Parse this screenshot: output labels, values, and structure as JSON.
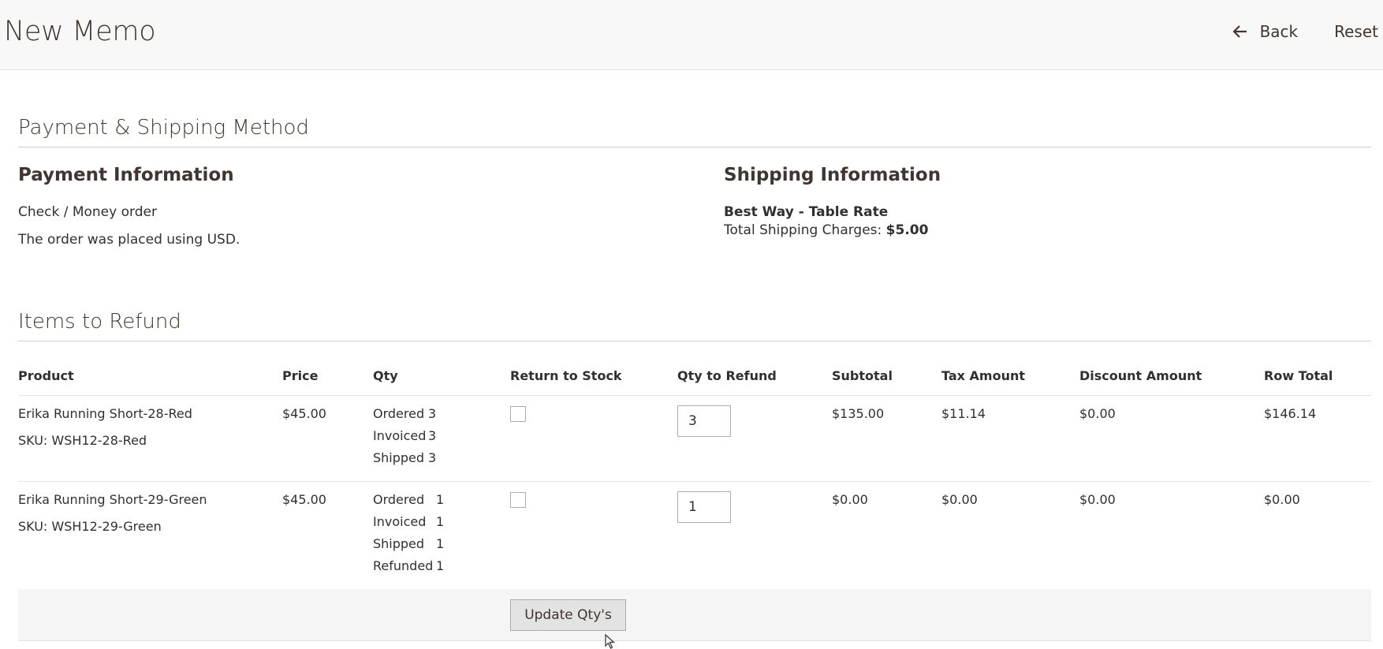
{
  "header": {
    "title": "New Memo",
    "back_label": "Back",
    "reset_label": "Reset"
  },
  "payment_shipping": {
    "section_title": "Payment & Shipping Method",
    "payment": {
      "title": "Payment Information",
      "method": "Check / Money order",
      "currency_note": "The order was placed using USD."
    },
    "shipping": {
      "title": "Shipping Information",
      "method": "Best Way - Table Rate",
      "charges_label": "Total Shipping Charges:",
      "charges_value": "$5.00"
    }
  },
  "items": {
    "section_title": "Items to Refund",
    "columns": [
      "Product",
      "Price",
      "Qty",
      "Return to Stock",
      "Qty to Refund",
      "Subtotal",
      "Tax Amount",
      "Discount Amount",
      "Row Total"
    ],
    "rows": [
      {
        "product": "Erika Running Short-28-Red",
        "sku": "SKU: WSH12-28-Red",
        "price": "$45.00",
        "qty": [
          {
            "label": "Ordered",
            "value": "3"
          },
          {
            "label": "Invoiced",
            "value": "3"
          },
          {
            "label": "Shipped",
            "value": "3"
          }
        ],
        "return_to_stock": false,
        "qty_to_refund": "3",
        "subtotal": "$135.00",
        "tax": "$11.14",
        "discount": "$0.00",
        "row_total": "$146.14"
      },
      {
        "product": "Erika Running Short-29-Green",
        "sku": "SKU: WSH12-29-Green",
        "price": "$45.00",
        "qty": [
          {
            "label": "Ordered",
            "value": "1"
          },
          {
            "label": "Invoiced",
            "value": "1"
          },
          {
            "label": "Shipped",
            "value": "1"
          },
          {
            "label": "Refunded",
            "value": "1"
          }
        ],
        "return_to_stock": false,
        "qty_to_refund": "1",
        "subtotal": "$0.00",
        "tax": "$0.00",
        "discount": "$0.00",
        "row_total": "$0.00"
      }
    ],
    "update_button_label": "Update Qty's"
  },
  "icons": {
    "back": "arrow-left-icon",
    "cursor": "mouse-pointer-icon"
  }
}
